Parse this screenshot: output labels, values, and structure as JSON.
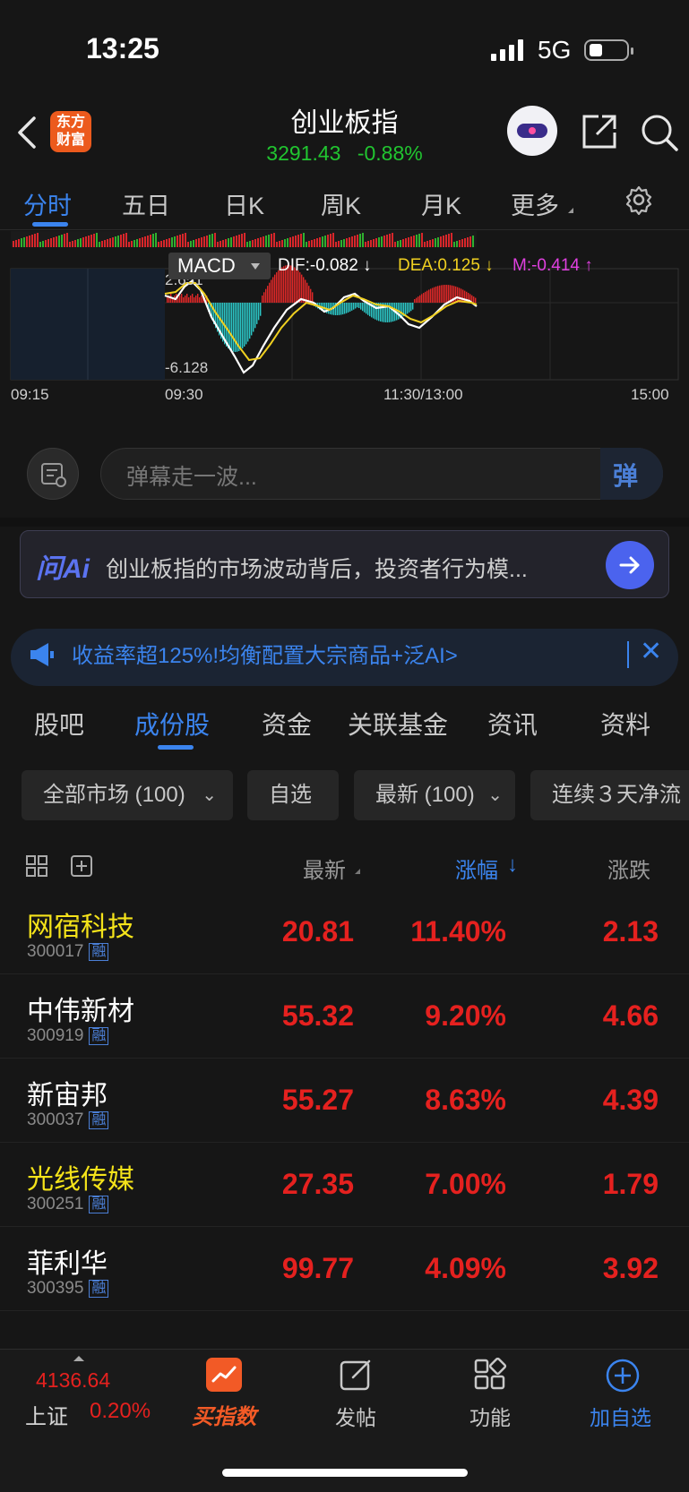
{
  "status_bar": {
    "time": "13:25",
    "network": "5G"
  },
  "header": {
    "logo_text": "东方财富",
    "title": "创业板指",
    "price": "3291.43",
    "change_pct": "-0.88%"
  },
  "period_tabs": [
    "分时",
    "五日",
    "日K",
    "周K",
    "月K",
    "更多"
  ],
  "chart": {
    "indicator": "MACD",
    "dif": "DIF:-0.082 ↓",
    "dea": "DEA:0.125 ↓",
    "m": "M:-0.414 ↑",
    "y_max": "2.651",
    "y_min": "-6.128",
    "x_labels": [
      "09:15",
      "09:30",
      "11:30/13:00",
      "15:00"
    ]
  },
  "danmu": {
    "placeholder": "弹幕走一波...",
    "send_label": "弹"
  },
  "ai_bar": {
    "logo": "问Ai",
    "text": "创业板指的市场波动背后，投资者行为模..."
  },
  "promo": {
    "text": "收益率超125%!均衡配置大宗商品+泛AI>"
  },
  "content_tabs": [
    "股吧",
    "成份股",
    "资金",
    "关联基金",
    "资讯",
    "资料"
  ],
  "filters": [
    "全部市场 (100)",
    "自选",
    "最新 (100)",
    "连续３天净流"
  ],
  "table_header": {
    "latest": "最新",
    "change_pct": "涨幅",
    "change": "涨跌"
  },
  "stocks": [
    {
      "name": "网宿科技",
      "code": "300017",
      "tag": "融",
      "price": "20.81",
      "pct": "11.40%",
      "chg": "2.13",
      "highlight": true
    },
    {
      "name": "中伟新材",
      "code": "300919",
      "tag": "融",
      "price": "55.32",
      "pct": "9.20%",
      "chg": "4.66",
      "highlight": false
    },
    {
      "name": "新宙邦",
      "code": "300037",
      "tag": "融",
      "price": "55.27",
      "pct": "8.63%",
      "chg": "4.39",
      "highlight": false
    },
    {
      "name": "光线传媒",
      "code": "300251",
      "tag": "融",
      "price": "27.35",
      "pct": "7.00%",
      "chg": "1.79",
      "highlight": true
    },
    {
      "name": "菲利华",
      "code": "300395",
      "tag": "融",
      "price": "99.77",
      "pct": "4.09%",
      "chg": "3.92",
      "highlight": false
    }
  ],
  "bottom_bar": {
    "index_value": "4136.64",
    "index_name": "上证",
    "index_pct": "0.20%",
    "buy_label": "买指数",
    "post_label": "发帖",
    "func_label": "功能",
    "add_label": "加自选"
  }
}
